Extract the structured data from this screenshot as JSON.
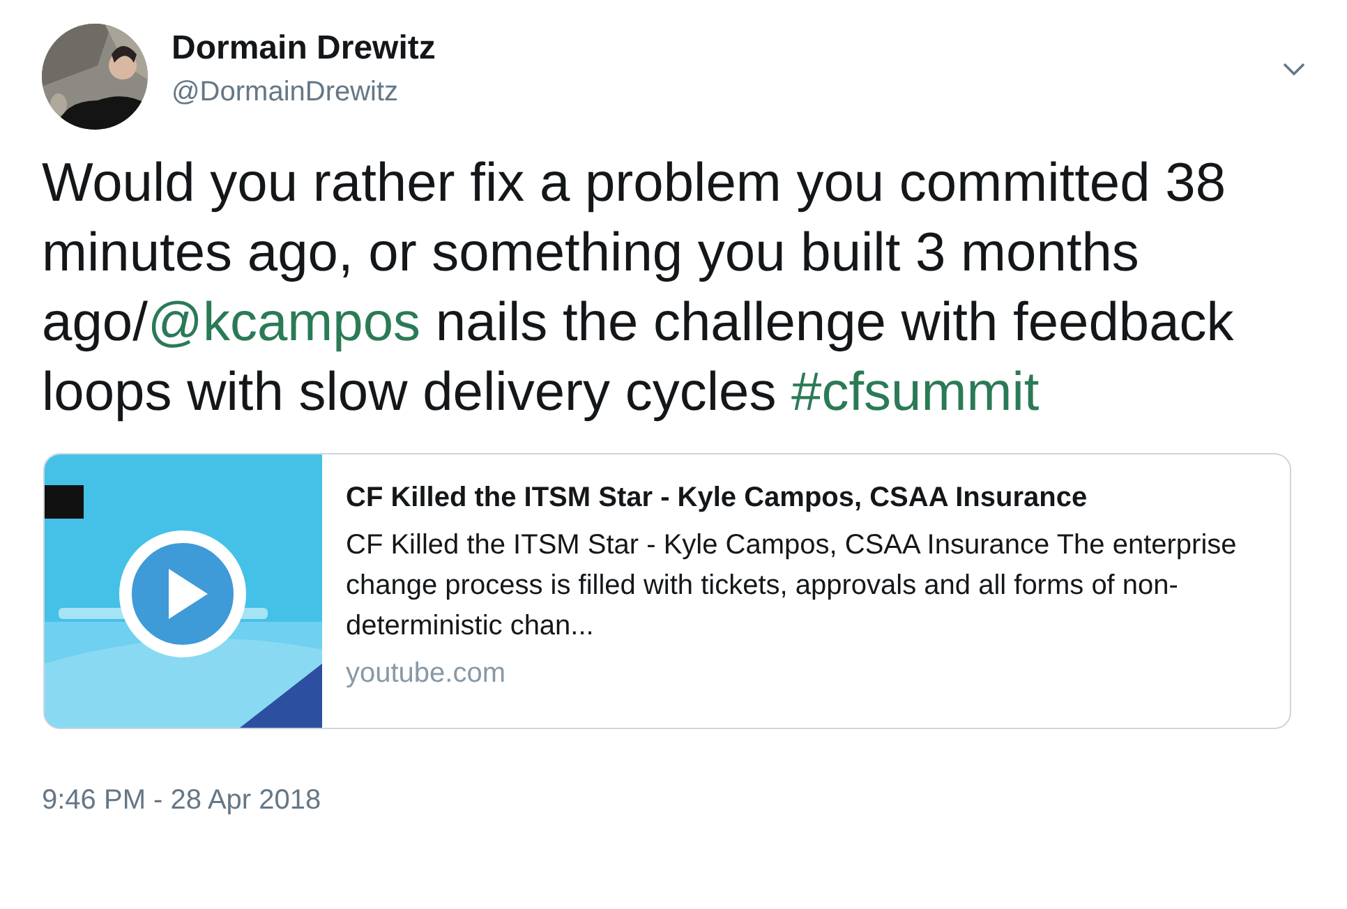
{
  "author": {
    "name": "Dormain Drewitz",
    "handle": "@DormainDrewitz"
  },
  "tweet": {
    "segments": [
      {
        "kind": "text",
        "text": "Would you rather fix a problem you committed 38 minutes ago, or something you built 3 months ago/"
      },
      {
        "kind": "mention",
        "text": "@kcampos"
      },
      {
        "kind": "text",
        "text": " nails the challenge with feedback loops with slow delivery cycles "
      },
      {
        "kind": "hashtag",
        "text": "#cfsummit"
      }
    ]
  },
  "card": {
    "title": "CF Killed the ITSM Star - Kyle Campos, CSAA Insurance",
    "description": "CF Killed the ITSM Star - Kyle Campos, CSAA Insurance The enterprise change process is filled with tickets, approvals and all forms of non-deterministic chan...",
    "domain": "youtube.com"
  },
  "timestamp": "9:46 PM - 28 Apr 2018"
}
